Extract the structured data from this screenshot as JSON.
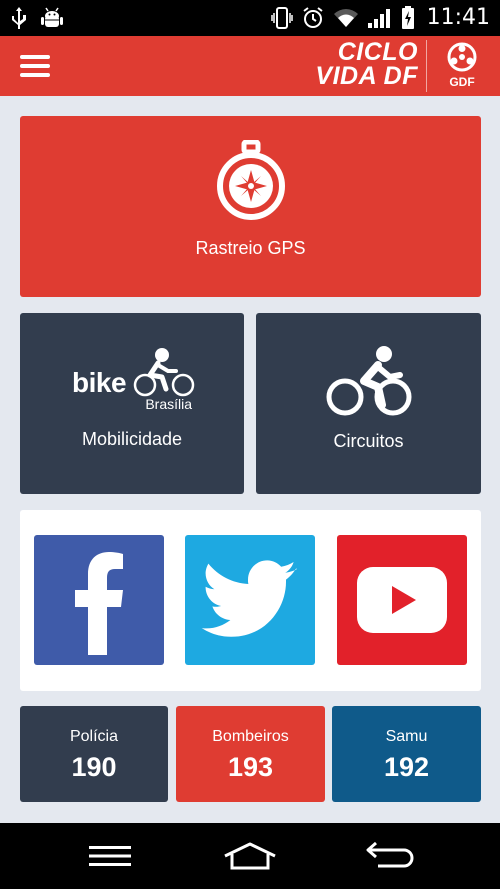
{
  "statusbar": {
    "time": "11:41",
    "icons": [
      "usb-icon",
      "android-debug-icon",
      "vibrate-icon",
      "alarm-icon",
      "wifi-icon",
      "signal-icon",
      "battery-charging-icon"
    ]
  },
  "appbar": {
    "brand_line1": "CICLO",
    "brand_line2": "VIDA DF",
    "gdf_label": "GDF",
    "color": "#df3c32"
  },
  "tiles": {
    "gps": {
      "label": "Rastreio GPS",
      "icon": "compass-icon"
    },
    "mobility": {
      "logo_bike": "bike",
      "logo_city": "Brasília",
      "label": "Mobilicidade",
      "icon": "bike-brasilia-logo"
    },
    "circuits": {
      "label": "Circuitos",
      "icon": "cyclist-icon"
    }
  },
  "social": [
    {
      "name": "facebook",
      "icon": "facebook-icon",
      "color": "#3f5ba9"
    },
    {
      "name": "twitter",
      "icon": "twitter-icon",
      "color": "#1ea9e1"
    },
    {
      "name": "youtube",
      "icon": "youtube-icon",
      "color": "#e2212a"
    }
  ],
  "emergency": [
    {
      "name": "Polícia",
      "number": "190",
      "color": "#323d4e"
    },
    {
      "name": "Bombeiros",
      "number": "193",
      "color": "#df3c32"
    },
    {
      "name": "Samu",
      "number": "192",
      "color": "#0f5a8a"
    }
  ],
  "navbar": {
    "icons": [
      "recent-apps-icon",
      "home-icon",
      "back-icon"
    ]
  }
}
